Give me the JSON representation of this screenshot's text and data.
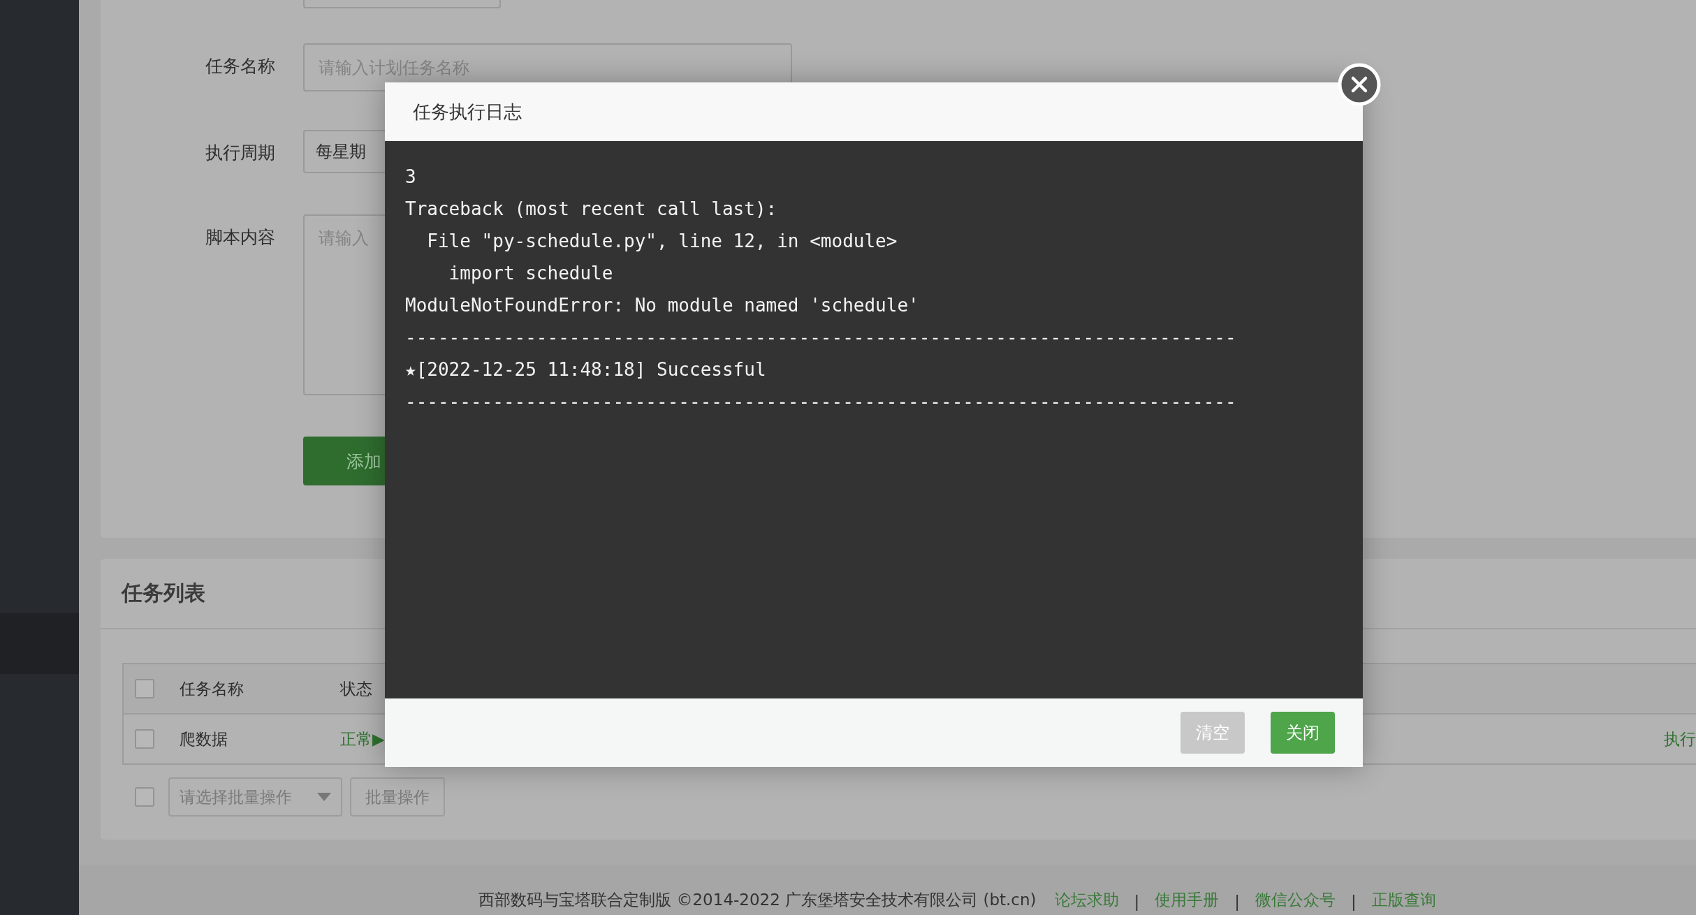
{
  "form": {
    "fields": [
      {
        "label": "任务名称",
        "kind": "input",
        "placeholder": "请输入计划任务名称"
      },
      {
        "label": "执行周期",
        "kind": "select",
        "value": "每星期"
      },
      {
        "label": "脚本内容",
        "kind": "textarea",
        "placeholder": "请输入"
      }
    ],
    "submit": "添加"
  },
  "task_list": {
    "title": "任务列表",
    "header_checked": false,
    "columns": [
      "任务名称",
      "状态"
    ],
    "rows": [
      {
        "checked": false,
        "name": "爬数据",
        "status": "正常▶",
        "action": "执行"
      }
    ],
    "batch": {
      "checked": false,
      "placeholder": "请选择批量操作",
      "button": "批量操作"
    }
  },
  "footer": {
    "text": "西部数码与宝塔联合定制版 ©2014-2022 广东堡塔安全技术有限公司 (bt.cn)",
    "links": [
      "论坛求助",
      "使用手册",
      "微信公众号",
      "正版查询"
    ],
    "separator": "|"
  },
  "modal": {
    "title": "任务执行日志",
    "log": [
      "3",
      "Traceback (most recent call last):",
      "  File \"py-schedule.py\", line 12, in <module>",
      "    import schedule",
      "ModuleNotFoundError: No module named 'schedule'",
      "----------------------------------------------------------------------------",
      "★[2022-12-25 11:48:18] Successful",
      "----------------------------------------------------------------------------"
    ],
    "buttons": [
      {
        "label": "清空",
        "kind": "secondary"
      },
      {
        "label": "关闭",
        "kind": "primary"
      }
    ]
  }
}
